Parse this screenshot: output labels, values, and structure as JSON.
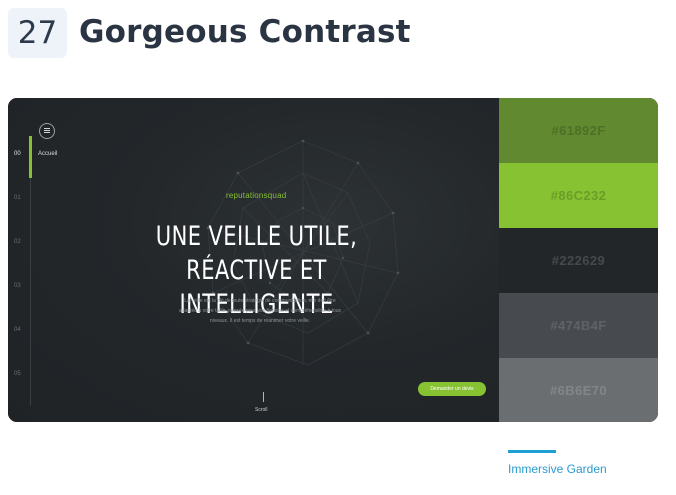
{
  "header": {
    "number": "27",
    "title": "Gorgeous Contrast"
  },
  "preview": {
    "nav": {
      "items": [
        "00",
        "01",
        "02",
        "03",
        "04",
        "05"
      ],
      "active_label": "Accueil"
    },
    "brand": "reputationsquad",
    "headline": [
      "UNE VEILLE UTILE,",
      "RÉACTIVE ET INTELLIGENTE"
    ],
    "intro": [
      "La veille est la clé de toute stratégie de communication, elle doit être",
      "adaptée à votre taille, pensée pour vos besoins et compréhensible à tous",
      "niveaux. Il est temps de réanimer votre veille."
    ],
    "scroll_label": "Scroll",
    "cta_label": "Demander un devis"
  },
  "palette": [
    {
      "hex": "#61892F",
      "bg": "#61892f",
      "text": "#4e6f26"
    },
    {
      "hex": "#86C232",
      "bg": "#86c232",
      "text": "#6c9d27"
    },
    {
      "hex": "#222629",
      "bg": "#222629",
      "text": "#45494c"
    },
    {
      "hex": "#474B4F",
      "bg": "#474b4f",
      "text": "#5f6367"
    },
    {
      "hex": "#6B6E70",
      "bg": "#6b6e70",
      "text": "#838688"
    }
  ],
  "credit": {
    "label": "Immersive Garden",
    "color": "#2a9bd0"
  }
}
